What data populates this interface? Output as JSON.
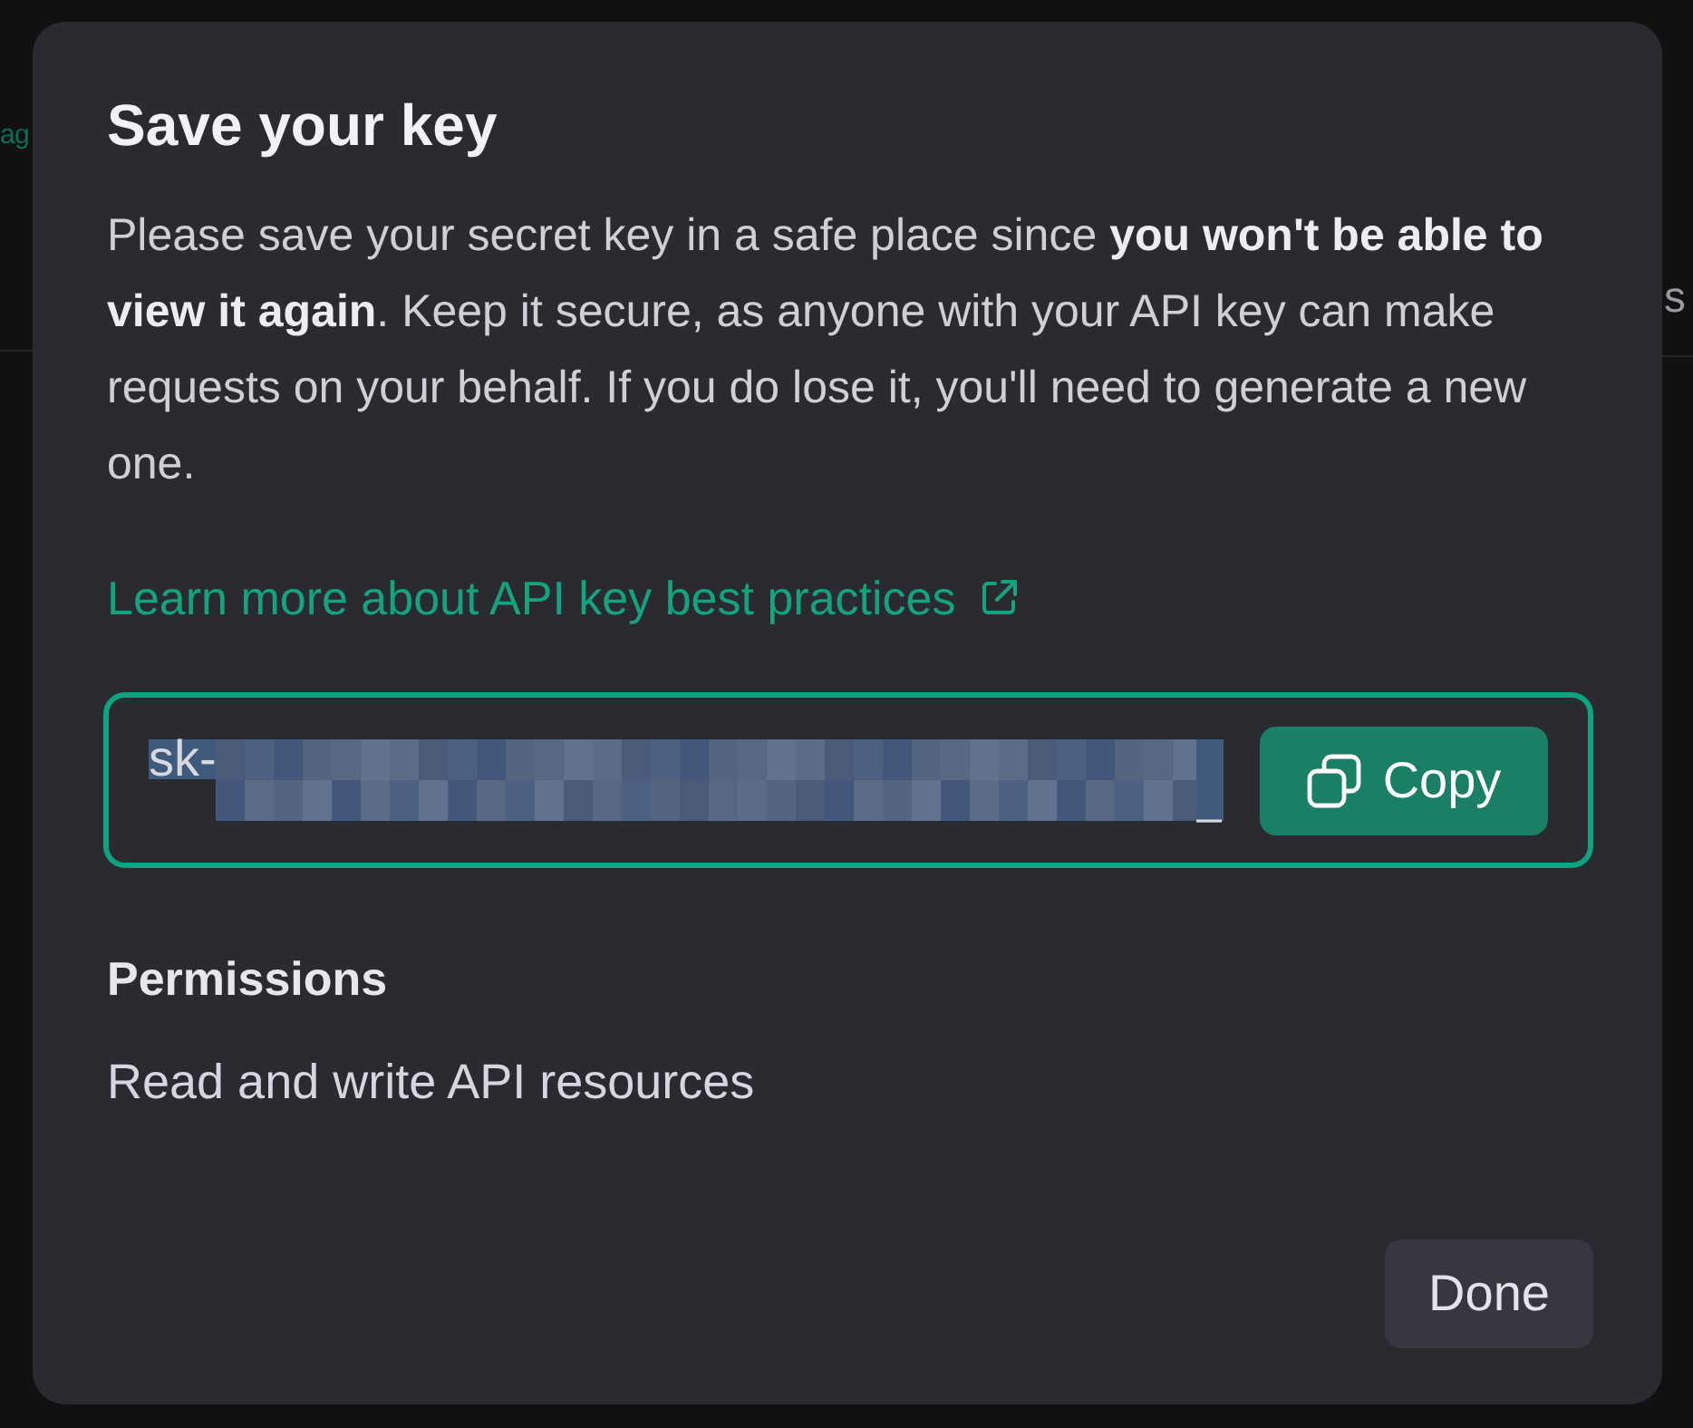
{
  "background": {
    "left_fragment": "ag",
    "right_fragment": "s"
  },
  "dialog": {
    "title": "Save your key",
    "message": "Please save your secret key in a safe place since **you won't be able to view it again**. Keep it secure, as anyone with your API key can make requests on your behalf. If you do lose it, you'll need to generate a new one.",
    "link": {
      "label": "Learn more about API key best practices"
    },
    "key_field": {
      "value_prefix": "sk-",
      "value_suffix": "_",
      "selected": true,
      "copy_button": {
        "label": "Copy"
      }
    },
    "permissions": {
      "label": "Permissions",
      "value": "Read and write API resources"
    },
    "buttons": [
      {
        "label": "Done"
      }
    ]
  }
}
